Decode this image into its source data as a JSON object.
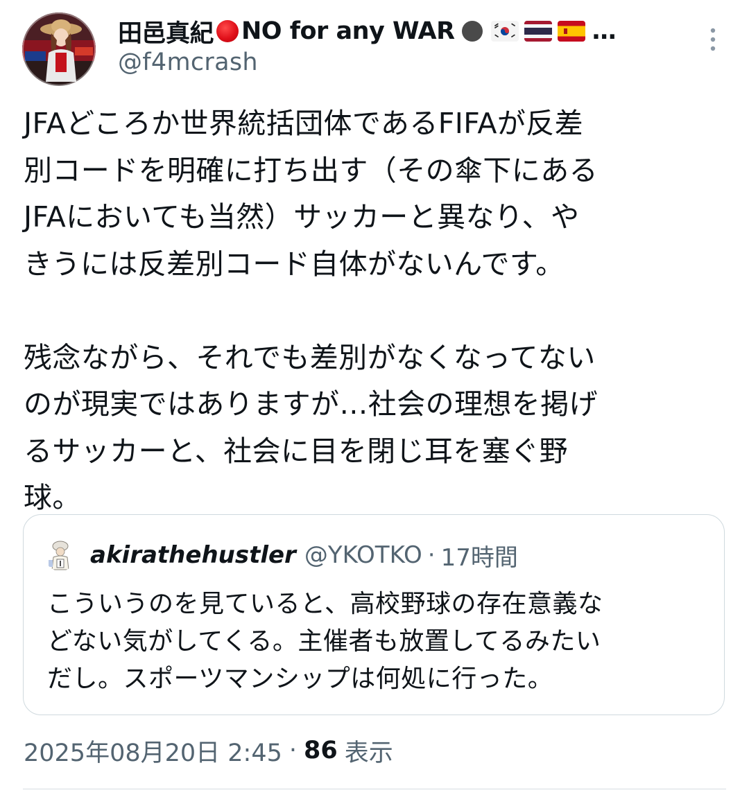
{
  "author": {
    "name_main": "田邑真紀",
    "name_mid": "NO for any WAR",
    "name_ellipsis": "…",
    "handle": "@f4mcrash",
    "icons": [
      "red-circle-emoji",
      "black-circle-emoji",
      "south-korea-flag",
      "thailand-flag",
      "spain-flag"
    ]
  },
  "tweet": {
    "text": "JFAどころか世界統括団体であるFIFAが反差\n別コードを明確に打ち出す（その傘下にある\nJFAにおいても当然）サッカーと異なり、や\nきうには反差別コード自体がないんです。\n\n残念ながら、それでも差別がなくなってない\nのが現実ではありますが…社会の理想を掲げ\nるサッカーと、社会に目を閉じ耳を塞ぐ野\n球。"
  },
  "quoted_tweet": {
    "name": "akirathehustler",
    "handle": "@YKOTKO",
    "separator": "·",
    "time": "17時間",
    "text": "こういうのを見ていると、高校野球の存在意義な\nどない気がしてくる。主催者も放置してるみたい\nだし。スポーツマンシップは何処に行った。"
  },
  "meta": {
    "date": "2025年08月20日 2:45",
    "separator": "·",
    "views_count": "86",
    "views_label": "表示"
  },
  "colors": {
    "text_primary": "#0f1419",
    "text_secondary": "#536471",
    "border": "#cfd9de",
    "red_circle": "#e0101a"
  }
}
